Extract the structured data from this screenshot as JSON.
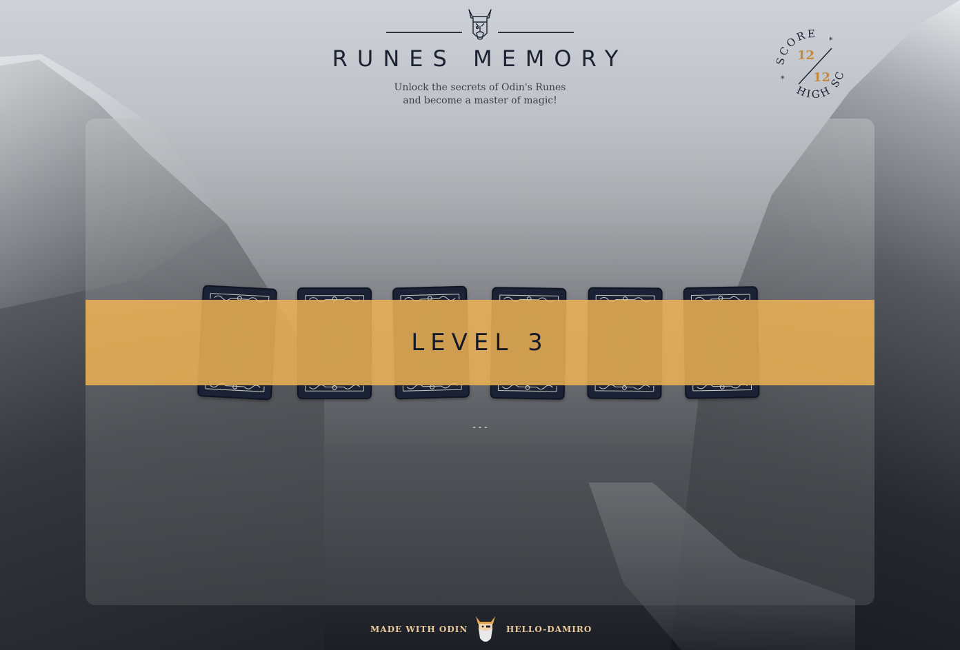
{
  "app": {
    "title": "Runes Memory",
    "subtitle_line1": "Unlock the secrets of Odin's Runes",
    "subtitle_line2": "and become a master of magic!"
  },
  "score": {
    "score_label": "SCORE",
    "score_value": "12",
    "high_score_label": "HIGH SCORE",
    "high_score_value": "12"
  },
  "game": {
    "level_label": "LEVEL 3",
    "status": "---",
    "cards": [
      {
        "state": "face-down"
      },
      {
        "state": "face-down"
      },
      {
        "state": "face-down"
      },
      {
        "state": "face-down"
      },
      {
        "state": "face-down"
      },
      {
        "state": "face-down"
      }
    ]
  },
  "footer": {
    "made_with": "MADE WITH ODIN",
    "author": "HELLO-DAMIRO"
  },
  "colors": {
    "accent": "#ecb254",
    "ink": "#1d2233",
    "card_back": "#1b2236",
    "score_gold": "#c48a3a"
  },
  "icons": {
    "header_logo": "viking-helmet-icon",
    "footer_logo": "odin-head-icon"
  }
}
